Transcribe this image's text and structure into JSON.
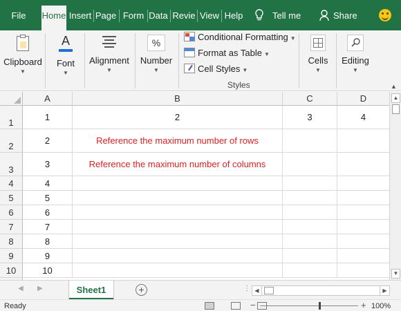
{
  "ribbon_tabs": {
    "file": "File",
    "home": "Home",
    "insert": "Insert",
    "page": "Page",
    "form": "Form",
    "data": "Data",
    "review": "Revie",
    "view": "View",
    "help": "Help",
    "tell_me": "Tell me",
    "share": "Share"
  },
  "ribbon": {
    "clipboard": "Clipboard",
    "font": "Font",
    "alignment": "Alignment",
    "number": "Number",
    "conditional_formatting": "Conditional Formatting",
    "format_as_table": "Format as Table",
    "cell_styles": "Cell Styles",
    "styles_group": "Styles",
    "cells": "Cells",
    "editing": "Editing",
    "number_icon_glyph": "%",
    "font_icon_glyph": "A"
  },
  "grid": {
    "columns": [
      "A",
      "B",
      "C",
      "D"
    ],
    "row_numbers": [
      "1",
      "2",
      "3",
      "4",
      "5",
      "6",
      "7",
      "8",
      "9",
      "10"
    ],
    "row1": [
      "1",
      "2",
      "3",
      "4"
    ],
    "col_a": [
      "2",
      "3",
      "4",
      "5",
      "6",
      "7",
      "8",
      "9",
      "10"
    ],
    "b2": "Reference the maximum number of rows",
    "b3": "Reference the maximum number of columns",
    "highlight_color": "#e02020"
  },
  "sheets": {
    "active": "Sheet1"
  },
  "status": {
    "ready": "Ready",
    "zoom": "100%"
  },
  "colors": {
    "accent": "#217346"
  }
}
